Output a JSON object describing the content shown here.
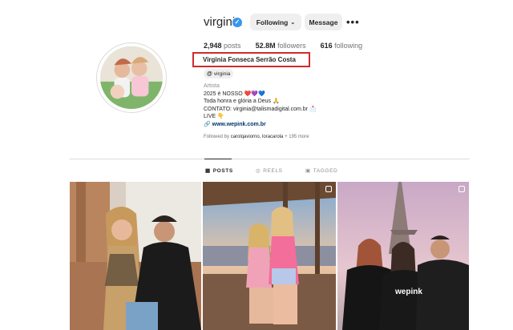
{
  "profile": {
    "username": "virginia",
    "following_button": "Following",
    "message_button": "Message",
    "full_name": "Virginia Fonseca Serrão Costa",
    "threads_handle": "virginia"
  },
  "stats": {
    "posts_count": "2,948",
    "posts_label": "posts",
    "followers_count": "52.8M",
    "followers_label": "followers",
    "following_count": "616",
    "following_label": "following"
  },
  "bio": {
    "category": "Artista",
    "line1": "2025 é NOSSO ❤️💜💙",
    "line2": "Toda honra e glória a Deus 🙏",
    "line3": "CONTATO: virginia@talismadigital.com.br 📩",
    "line4": "LIVE 👇",
    "link": "www.wepink.com.br"
  },
  "followed_by": {
    "prefix": "Followed by",
    "names": "carolqaviorno, loracarola",
    "suffix": "+ 195 more"
  },
  "tabs": {
    "posts": "POSTS",
    "reels": "REELS",
    "tagged": "TAGGED"
  },
  "posts": [
    {
      "photo_text": ""
    },
    {
      "photo_text": ""
    },
    {
      "photo_text": "wepink"
    }
  ],
  "colors": {
    "verified": "#3897f0",
    "highlight_box": "#d12b2b",
    "link": "#00376b"
  }
}
